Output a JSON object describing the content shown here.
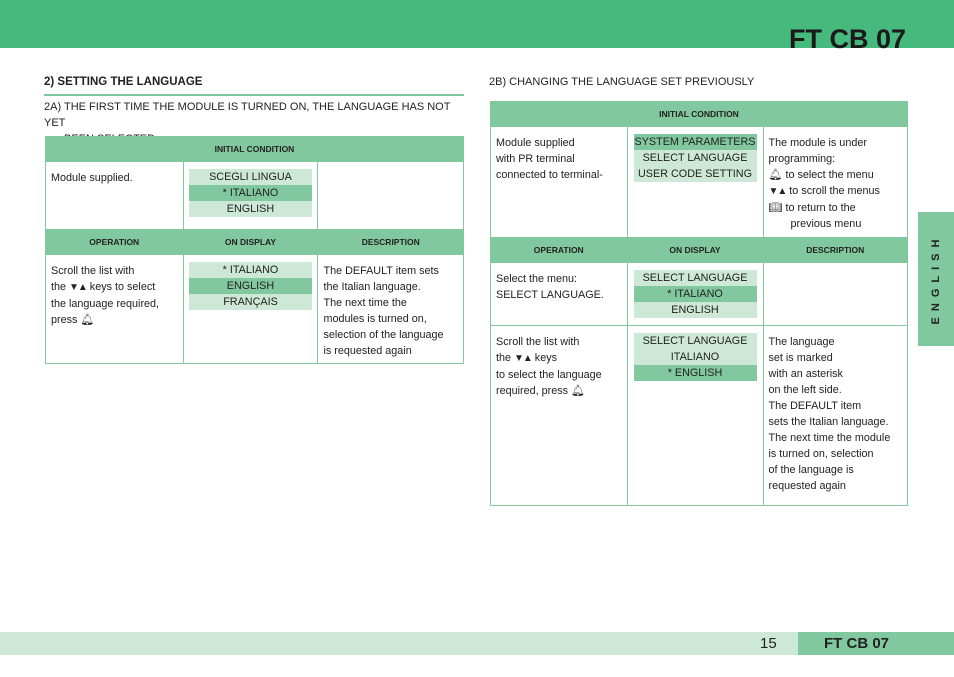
{
  "header": {
    "brand": "FT CB 07",
    "accent_color": "#46b97c"
  },
  "section": {
    "title": "2) SETTING THE LANGUAGE",
    "sub_a": {
      "line1": "2A) THE FIRST TIME THE MODULE IS TURNED ON, THE LANGUAGE HAS NOT YET",
      "line2": "BEEN SELECTED"
    },
    "sub_b": "2B) CHANGING THE LANGUAGE SET PREVIOUSLY"
  },
  "table_a": {
    "initial_header": "INITIAL CONDITION",
    "initial": {
      "operation": "Module supplied.",
      "display": [
        "SCEGLI LINGUA",
        "* ITALIANO",
        "ENGLISH"
      ],
      "selected_index": 1,
      "description": ""
    },
    "columns": [
      "OPERATION",
      "ON DISPLAY",
      "DESCRIPTION"
    ],
    "rows": [
      {
        "operation": {
          "l1": "Scroll the list with",
          "l2a": "the ",
          "l2b": " keys  to select",
          "l3": "the language required,",
          "l4": "press "
        },
        "display": [
          "* ITALIANO",
          "ENGLISH",
          "FRANÇAIS"
        ],
        "selected_index": 1,
        "description": [
          "The DEFAULT item sets",
          "the Italian language.",
          "The next time the",
          "modules is turned on,",
          "selection of the language",
          "is requested again"
        ]
      }
    ]
  },
  "table_b": {
    "initial_header": "INITIAL CONDITION",
    "initial": {
      "operation": [
        "Module supplied",
        "with PR terminal",
        "connected to terminal-"
      ],
      "display": [
        "SYSTEM PARAMETERS",
        "SELECT LANGUAGE",
        "USER CODE SETTING"
      ],
      "selected_index": 0,
      "description": {
        "l1": "The module is under",
        "l2": "programming:",
        "enter": " to select the menu",
        "arrows": " to scroll the menus",
        "back": " to return to the",
        "back2": "previous menu"
      }
    },
    "columns": [
      "OPERATION",
      "ON DISPLAY",
      "DESCRIPTION"
    ],
    "rows": [
      {
        "operation": [
          "Select the menu:",
          "SELECT LANGUAGE."
        ],
        "display": [
          "SELECT LANGUAGE",
          "* ITALIANO",
          "ENGLISH"
        ],
        "selected_index": 1,
        "description": []
      },
      {
        "operation": {
          "l1": "Scroll the list with",
          "l2a": "the  ",
          "l2b": " keys",
          "l3": "to select the language",
          "l4": "required, press "
        },
        "display": [
          "SELECT LANGUAGE",
          "ITALIANO",
          "* ENGLISH"
        ],
        "selected_index": 2,
        "description": [
          "The language",
          "set is marked",
          "with an asterisk",
          "on the left side.",
          "The DEFAULT item",
          "sets the Italian language.",
          "The next time the module",
          "is turned on, selection",
          "of the language is",
          "requested again"
        ]
      }
    ]
  },
  "icons": {
    "enter": "bell-icon",
    "arrows": "down-up-arrows-icon",
    "back": "book-icon"
  },
  "side_tab": {
    "label": "ENGLISH"
  },
  "footer": {
    "page_number": "15",
    "brand": "FT CB 07"
  }
}
